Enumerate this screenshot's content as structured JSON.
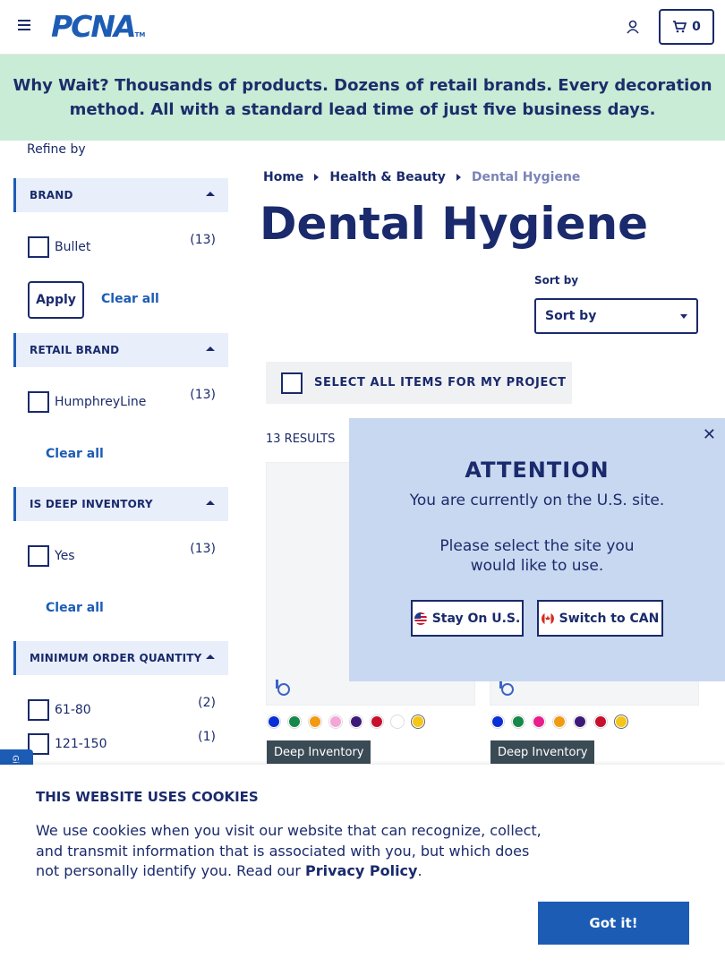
{
  "header": {
    "logo_text": "PCNA",
    "logo_tm": "TM",
    "cart_count": "0"
  },
  "promo": {
    "lead": "Why Wait?",
    "text": " Thousands of products. Dozens of retail brands. Every decoration method. All with a standard lead time of just five business days."
  },
  "sidebar": {
    "refine_label": "Refine by",
    "facets": [
      {
        "title": "BRAND",
        "options": [
          {
            "label": "Bullet",
            "count": "(13)"
          }
        ],
        "apply_label": "Apply",
        "clear_label": "Clear all"
      },
      {
        "title": "RETAIL BRAND",
        "options": [
          {
            "label": "HumphreyLine",
            "count": "(13)"
          }
        ],
        "clear_label": "Clear all"
      },
      {
        "title": "IS DEEP INVENTORY",
        "options": [
          {
            "label": "Yes",
            "count": "(13)"
          }
        ],
        "clear_label": "Clear all"
      },
      {
        "title": "MINIMUM ORDER QUANTITY",
        "options": [
          {
            "label": "61-80",
            "count": "(2)"
          },
          {
            "label": "121-150",
            "count": "(1)"
          }
        ]
      }
    ]
  },
  "breadcrumb": [
    {
      "label": "Home"
    },
    {
      "label": "Health & Beauty"
    },
    {
      "label": "Dental Hygiene"
    }
  ],
  "page_title": "Dental Hygiene",
  "sort": {
    "label": "Sort by",
    "value": "Sort by"
  },
  "select_all_label": "SELECT ALL ITEMS FOR MY PROJECT",
  "results_count": "13 RESULTS",
  "products": [
    {
      "badge": "Deep Inventory",
      "swatches": [
        "#0a2fd6",
        "#15884a",
        "#f29a12",
        "#f4a6d6",
        "#3d1a78",
        "#c8102e",
        "#ffffff",
        "#f5c518"
      ]
    },
    {
      "badge": "Deep Inventory",
      "swatches": [
        "#0a2fd6",
        "#15884a",
        "#e91e8c",
        "#f29a12",
        "#3d1a78",
        "#c8102e",
        "#f5c518"
      ]
    }
  ],
  "modal": {
    "title": "ATTENTION",
    "message1": "You are currently on the U.S. site.",
    "message2_line1": "Please select the site you",
    "message2_line2": "would like to use.",
    "stay_label": "Stay On U.S.",
    "switch_label": "Switch to CAN",
    "close_glyph": "✕"
  },
  "side_tab_label": "Gi",
  "cookie": {
    "title": "THIS WEBSITE USES COOKIES",
    "text": "We use cookies when you visit our website that can recognize, collect, and transmit information that is associated with you, but which does not personally identify you. Read our ",
    "link": "Privacy Policy",
    "period": ".",
    "button": "Got it!"
  },
  "colors": {
    "navy": "#1a2a6c",
    "brand_blue": "#1c5cb5",
    "promo_bg": "#c9ecd6",
    "modal_bg": "#c8d8f0"
  }
}
